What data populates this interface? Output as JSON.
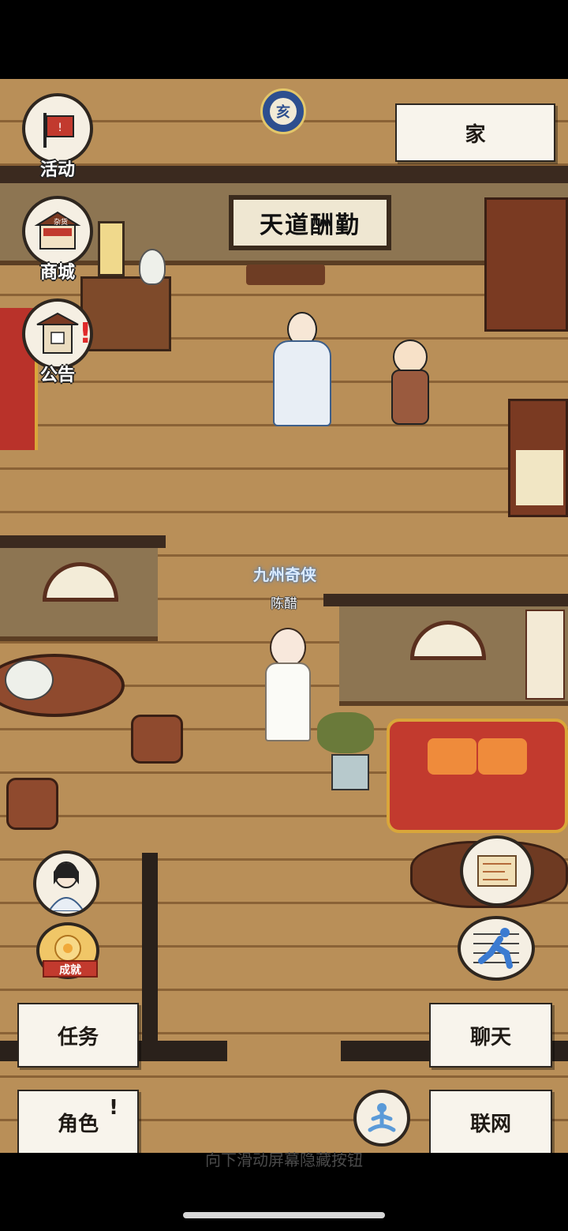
{
  "header": {
    "time_badge": "亥",
    "location_button": "家"
  },
  "left_menu": {
    "activity_label": "活动",
    "shop_label": "商城",
    "shop_sign": "杂货",
    "notice_label": "公告",
    "achievement_label": "成就"
  },
  "scene": {
    "sign_text": "天道酬勤",
    "player_title": "九州奇侠",
    "player_name": "陈醋"
  },
  "bottom_buttons": {
    "tasks": "任务",
    "chat": "聊天",
    "character": "角色",
    "character_alert": "!",
    "network": "联网"
  },
  "hint": "向下滑动屏幕隐藏按钮",
  "colors": {
    "floor": "#b98f58",
    "paper": "#f8f4ec",
    "outline": "#2c2620",
    "sofa": "#c23a2e"
  }
}
